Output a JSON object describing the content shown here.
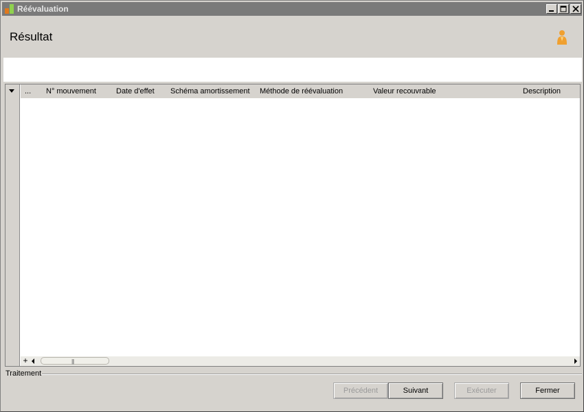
{
  "window": {
    "title": "Réévaluation"
  },
  "header": {
    "title": "Résultat",
    "user_icon": "user-icon"
  },
  "grid": {
    "columns": [
      "...",
      "N° mouvement",
      "Date d'effet",
      "Schéma amortissement",
      "Méthode de réévaluation",
      "Valeur recouvrable",
      "Description"
    ],
    "rows": [],
    "add_label": "+"
  },
  "group": {
    "label": "Traitement"
  },
  "buttons": {
    "previous": "Précédent",
    "next": "Suivant",
    "execute": "Exécuter",
    "close": "Fermer"
  },
  "colors": {
    "titlebar": "#7a7a7a",
    "window_bg": "#d6d3ce",
    "user_icon": "#f0a030"
  }
}
